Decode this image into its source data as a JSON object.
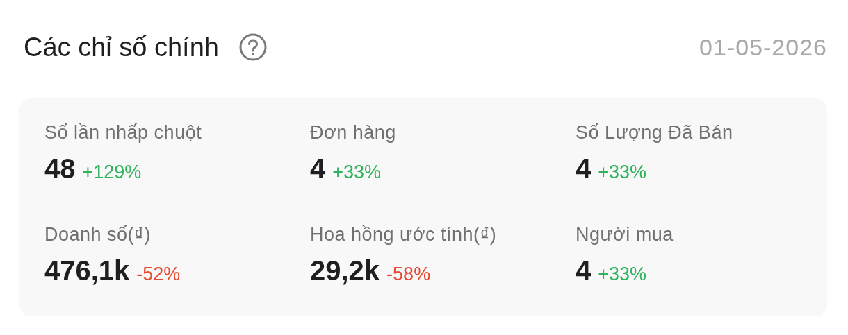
{
  "header": {
    "title": "Các chỉ số chính",
    "date": "01-05-2026"
  },
  "metrics": [
    {
      "label": "Số lần nhấp chuột",
      "value": "48",
      "change": "+129%",
      "kind": "up"
    },
    {
      "label": "Đơn hàng",
      "value": "4",
      "change": "+33%",
      "kind": "up"
    },
    {
      "label": "Số Lượng Đã Bán",
      "value": "4",
      "change": "+33%",
      "kind": "up"
    },
    {
      "label": "Doanh số(₫)",
      "value": "476,1k",
      "change": "-52%",
      "kind": "down"
    },
    {
      "label": "Hoa hồng ước tính(₫)",
      "value": "29,2k",
      "change": "-58%",
      "kind": "down"
    },
    {
      "label": "Người mua",
      "value": "4",
      "change": "+33%",
      "kind": "up"
    }
  ]
}
